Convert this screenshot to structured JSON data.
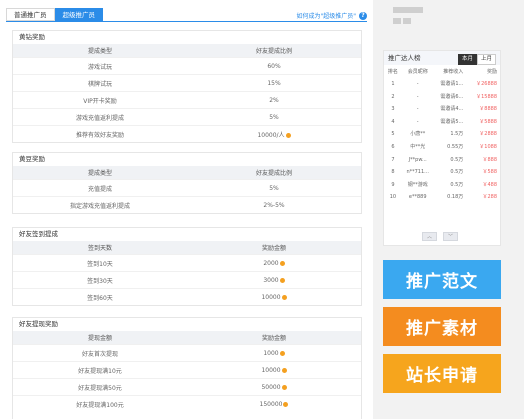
{
  "tabs": [
    {
      "label": "普通推广员"
    },
    {
      "label": "超级推广员"
    }
  ],
  "help": {
    "text": "如何成为\"超级推广员\"",
    "icon": "help-icon"
  },
  "sections": [
    {
      "title": "黄钻奖励",
      "headers": [
        "提成类型",
        "好友提成比例"
      ],
      "rows": [
        [
          "游戏试玩",
          "60%"
        ],
        [
          "棋牌试玩",
          "15%"
        ],
        [
          "VIP开卡奖励",
          "2%"
        ],
        [
          "游戏充值返利提成",
          "5%"
        ],
        [
          "推荐有效好友奖励",
          "10000/人"
        ]
      ]
    },
    {
      "title": "黄豆奖励",
      "headers": [
        "提成类型",
        "好友提成比例"
      ],
      "rows": [
        [
          "充值提成",
          "5%"
        ],
        [
          "指定游戏充值返利提成",
          "2%-5%"
        ]
      ]
    },
    {
      "title": "好友签到提成",
      "headers": [
        "签到天数",
        "奖励金额"
      ],
      "rows": [
        [
          "签到10天",
          "2000"
        ],
        [
          "签到30天",
          "3000"
        ],
        [
          "签到60天",
          "10000"
        ]
      ]
    },
    {
      "title": "好友提现奖励",
      "headers": [
        "提现金额",
        "奖励金额"
      ],
      "rows": [
        [
          "好友首次提现",
          "1000"
        ],
        [
          "好友提现满10元",
          "10000"
        ],
        [
          "好友提现满50元",
          "50000"
        ],
        [
          "好友提现满100元",
          "150000"
        ]
      ]
    }
  ],
  "ranking": {
    "title": "推广达人榜",
    "tabs": [
      "本月",
      "上月"
    ],
    "columns": [
      "排名",
      "会员昵称",
      "推荐收入",
      "奖励"
    ],
    "rows": [
      [
        "1",
        "-",
        "需邀请1...",
        "￥26888"
      ],
      [
        "2",
        "-",
        "需邀请6...",
        "￥15888"
      ],
      [
        "3",
        "-",
        "需邀请4...",
        "￥8888"
      ],
      [
        "4",
        "-",
        "需邀请5...",
        "￥5888"
      ],
      [
        "5",
        "小唐**",
        "1.5万",
        "￥2888"
      ],
      [
        "6",
        "中**光",
        "0.55万",
        "￥1088"
      ],
      [
        "7",
        "J**pw...",
        "0.5万",
        "￥888"
      ],
      [
        "8",
        "n**711...",
        "0.5万",
        "￥588"
      ],
      [
        "9",
        "钢**游戏",
        "0.5万",
        "￥488"
      ],
      [
        "10",
        "e**889",
        "0.18万",
        "￥288"
      ]
    ]
  },
  "banners": [
    {
      "label": "推广范文",
      "color": "#3aa8f0"
    },
    {
      "label": "推广素材",
      "color": "#f48c1f"
    },
    {
      "label": "站长申请",
      "color": "#f6a51d"
    }
  ]
}
